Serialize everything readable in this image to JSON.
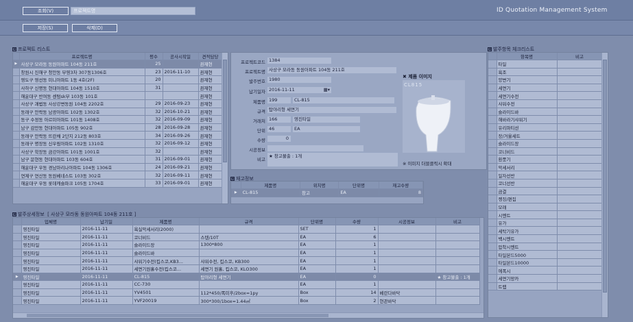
{
  "top": {
    "search_btn": "조회(V)",
    "search_placeholder": "프로젝트명",
    "app_title": "ID Quotation Management System",
    "save_btn": "저장(S)",
    "delete_btn": "삭제(D)"
  },
  "project_list": {
    "title": "프로젝트 리스트",
    "columns": [
      "프로젝트명",
      "평수",
      "공사시작일",
      "견적담당"
    ],
    "rows": [
      [
        "사상구 모라동 동원아파트 104동 211호",
        "25",
        "",
        "권재현"
      ],
      [
        "창원시 진해구 청안동 부영3차 307동1306호",
        "23",
        "2016-11-10",
        "권재현"
      ],
      [
        "영도구 영선동 미니아파트 1동 4호(2F)",
        "20",
        "",
        "권재현"
      ],
      [
        "사하구 신평동 현대아파트 104동 1510호",
        "31",
        "",
        "권재현"
      ],
      [
        "해운대구 반여동 센텀sk부 103동 101호",
        "",
        "",
        "권재현"
      ],
      [
        "사상구 괘법동 사상강변동원 104동 2202호",
        "29",
        "2016-09-23",
        "권재현"
      ],
      [
        "동래구 안락동 남광아파트 102동 1302호",
        "32",
        "2016-10-21",
        "권재현"
      ],
      [
        "동구 수정동 아르미아파트 101동 1408호",
        "32",
        "2016-09-09",
        "권재현"
      ],
      [
        "남구 감만동 현대아파트 105동 902호",
        "28",
        "2016-09-28",
        "권재현"
      ],
      [
        "동래구 안락동 뜨란채 2단지 212동 803호",
        "34",
        "2016-09-26",
        "권재현"
      ],
      [
        "동래구 명장동 신우림아파트 102동 1310호",
        "32",
        "2016-09-12",
        "권재현"
      ],
      [
        "사상구 학장동 금강아파트 101동 1001호",
        "32",
        "",
        "권재현"
      ],
      [
        "남구 문현동 현대아파트 103동 604호",
        "31",
        "2016-09-01",
        "권재현"
      ],
      [
        "해운대구 우동 경남마리나아파트 104동 1306호",
        "24",
        "2016-09-21",
        "권재현"
      ],
      [
        "연제구 연산동 동원베네스트 103동 302호",
        "32",
        "2016-09-11",
        "권재현"
      ],
      [
        "해운대구 우동 롯데캐슬파크 105동 1704호",
        "33",
        "2016-09-01",
        "권재현"
      ]
    ]
  },
  "detail": {
    "labels": {
      "code": "프로젝트코드",
      "name": "프로젝트명",
      "order_no": "발주번호",
      "delivery": "납기일자",
      "product": "제품명",
      "spec": "규격",
      "supplier": "거래처",
      "unit": "단위",
      "qty": "수량",
      "install": "시공정보",
      "note": "비고"
    },
    "code": "1384",
    "name": "사상구 모라동 동원아파트 104동 211호",
    "order_no": "1980",
    "delivery": "2016-11-11",
    "product_id": "199",
    "product_code": "CL-815",
    "spec": "탑야리형 세면기",
    "supplier_id": "166",
    "supplier_name": "영진타일",
    "unit_id": "46",
    "unit_name": "EA",
    "qty": "0",
    "install": "",
    "note": "★ 창고불출 : 1개",
    "image_title": "제품 이미지",
    "image_code": "CL815",
    "image_hint": "※ 이미지 더블클릭시 확대"
  },
  "stock": {
    "title": "재고정보",
    "columns": [
      "제품명",
      "위치명",
      "단위명",
      "재고수량"
    ],
    "rows": [
      [
        "CL-815",
        "창고",
        "EA",
        "8"
      ]
    ]
  },
  "orders": {
    "title": "발주상세정보",
    "project": "[ 사상구 모라동 동원아파트 104동 211호 ]",
    "columns": [
      "업체명",
      "납기일",
      "제품명",
      "규격",
      "단위명",
      "수량",
      "시공정보",
      "비고"
    ],
    "rows": [
      [
        "영진타일",
        "2016-11-11",
        "욕실악세서리(2000)",
        "",
        "SET",
        "1",
        "",
        ""
      ],
      [
        "영진타일",
        "2016-11-11",
        "코너비드",
        "스텐/10T",
        "EA",
        "6",
        "",
        ""
      ],
      [
        "영진타일",
        "2016-11-11",
        "슬라이드장",
        "1300*800",
        "EA",
        "1",
        "",
        ""
      ],
      [
        "영진타일",
        "2016-11-11",
        "슬라이드바",
        "",
        "EA",
        "1",
        "",
        ""
      ],
      [
        "영진타일",
        "2016-11-11",
        "샤워기수전(킵스코,KB3...",
        "샤워수전, 킵스코, KB300",
        "EA",
        "1",
        "",
        ""
      ],
      [
        "영진타일",
        "2016-11-11",
        "세면기원홀수전(킵스코...",
        "세면기 원홀, 킵스코, KLO300",
        "EA",
        "1",
        "",
        ""
      ],
      [
        "영진타일",
        "2016-11-11",
        "CL-815",
        "탑야리형 세면기",
        "EA",
        "0",
        "",
        "★ 창고불출 : 1개"
      ],
      [
        "영진타일",
        "2016-11-11",
        "CC-730",
        "",
        "EA",
        "1",
        "",
        ""
      ],
      [
        "영진타일",
        "2016-11-11",
        "YV4501",
        "112*450/폭미후/2box=1py",
        "Box",
        "14",
        "베란다바닥",
        ""
      ],
      [
        "영진타일",
        "2016-11-11",
        "YVF20019",
        "300*300/1box=1.44㎡",
        "Box",
        "2",
        "현관바닥",
        ""
      ]
    ]
  },
  "checklist": {
    "title": "발주항목 체크리스트",
    "columns": [
      "항목명",
      "비고"
    ],
    "items": [
      "타일",
      "욕조",
      "양변기",
      "세면기",
      "세면기수전",
      "샤워수전",
      "슬라이드바",
      "해바라기샤워기",
      "유리파티션",
      "장/거울세트",
      "슬라이드장",
      "코너비드",
      "환풍기",
      "악세서리",
      "일자선반",
      "코너선반",
      "금결",
      "젱징/편집",
      "모래",
      "시멘트",
      "유가",
      "세탁기유가",
      "백시멘트",
      "압착시멘트",
      "타일본드5000",
      "타일본드10000",
      "에폭시",
      "세면기망카",
      "트랩"
    ]
  }
}
